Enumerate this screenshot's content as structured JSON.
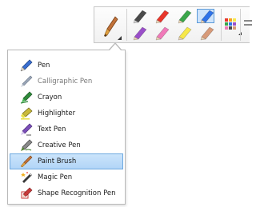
{
  "toolbar": {
    "current_pen_icon": "paint-brush-icon",
    "swatches": [
      {
        "name": "black",
        "color": "#4a4a4a",
        "selected": false
      },
      {
        "name": "red",
        "color": "#e8362b",
        "selected": false
      },
      {
        "name": "green",
        "color": "#3aa64a",
        "selected": false
      },
      {
        "name": "blue",
        "color": "#2f73e8",
        "selected": true
      },
      {
        "name": "purple",
        "color": "#9a4fc9",
        "selected": false
      },
      {
        "name": "pink",
        "color": "#f07ab9",
        "selected": false
      },
      {
        "name": "yellow",
        "color": "#f7e84a",
        "selected": false
      },
      {
        "name": "tan",
        "color": "#d79a78",
        "selected": false
      }
    ],
    "palette_icon": "color-palette-icon",
    "more_icon": "more-options-icon"
  },
  "menu": {
    "items": [
      {
        "label": "Pen",
        "icon": "pen-icon",
        "disabled": false,
        "selected": false
      },
      {
        "label": "Calligraphic Pen",
        "icon": "calligraphic-pen-icon",
        "disabled": true,
        "selected": false
      },
      {
        "label": "Crayon",
        "icon": "crayon-icon",
        "disabled": false,
        "selected": false
      },
      {
        "label": "Highlighter",
        "icon": "highlighter-icon",
        "disabled": false,
        "selected": false
      },
      {
        "label": "Text Pen",
        "icon": "text-pen-icon",
        "disabled": false,
        "selected": false
      },
      {
        "label": "Creative Pen",
        "icon": "creative-pen-icon",
        "disabled": false,
        "selected": false
      },
      {
        "label": "Paint Brush",
        "icon": "paint-brush-icon",
        "disabled": false,
        "selected": true
      },
      {
        "label": "Magic Pen",
        "icon": "magic-pen-icon",
        "disabled": false,
        "selected": false
      },
      {
        "label": "Shape Recognition Pen",
        "icon": "shape-recognition-pen-icon",
        "disabled": false,
        "selected": false
      }
    ]
  }
}
